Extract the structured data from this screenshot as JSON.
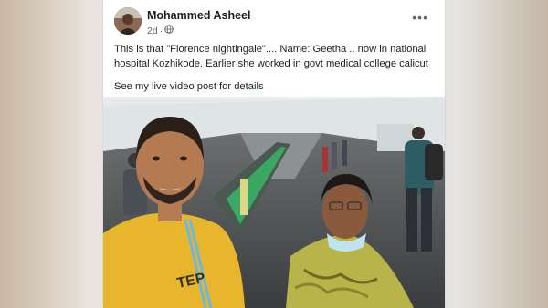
{
  "post": {
    "author": "Mohammed Asheel",
    "time": "2d",
    "separator": "·",
    "more_label": "•••",
    "text_line1": "This is that \"Florence nightingale\".... Name: Geetha .. now in national",
    "text_line2": "hospital Kozhikode. Earlier she worked in govt medical college calicut",
    "text_line3": "See my live video post for details"
  },
  "icons": {
    "privacy": "globe-icon",
    "more": "ellipsis-icon"
  },
  "colors": {
    "author_text": "#1c1e21",
    "meta_text": "#65676b",
    "card_bg": "#ffffff"
  }
}
